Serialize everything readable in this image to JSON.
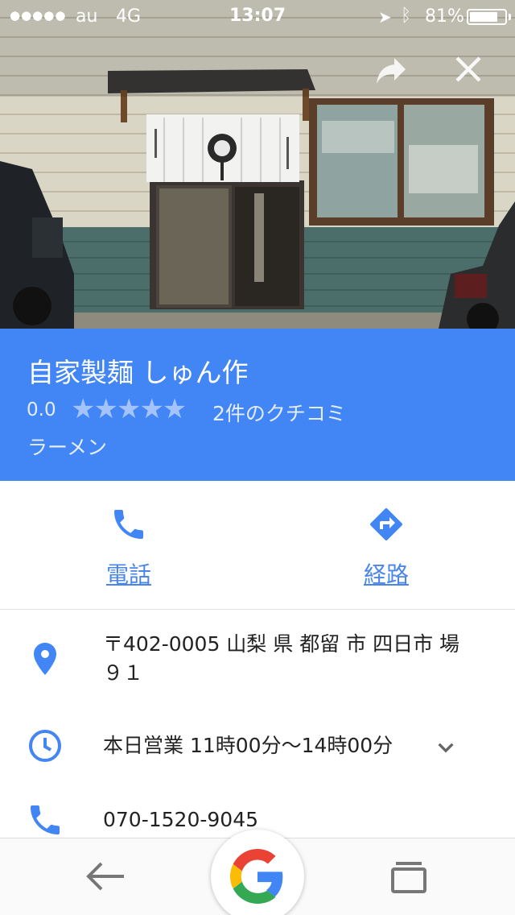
{
  "status_bar": {
    "signal": "●●●●●",
    "carrier": "au",
    "network": "4G",
    "time": "13:07",
    "battery": "81%",
    "battery_level": 0.81
  },
  "place": {
    "name": "自家製麺 しゅん作",
    "rating": "0.0",
    "stars": "★★★★★",
    "reviews": "2件のクチコミ",
    "category": "ラーメン"
  },
  "actions": {
    "call_label": "電話",
    "route_label": "経路"
  },
  "details": {
    "address_line1": "〒402-0005 山梨 県 都留 市 四日市 場",
    "address_line2": "９１",
    "hours": "本日営業 11時00分～14時00分",
    "phone": "070-1520-9045"
  },
  "colors": {
    "header_blue": "#4285f4",
    "accent_blue": "#4285f4",
    "link_blue": "#4a86e8"
  },
  "icons": {
    "share": "share-icon",
    "close": "close-icon",
    "phone": "phone-icon",
    "directions": "directions-icon",
    "location": "location-pin-icon",
    "clock": "clock-icon",
    "expand": "chevron-down-icon",
    "back": "back-arrow-icon",
    "tabs": "tabs-icon",
    "google": "google-logo-icon"
  }
}
